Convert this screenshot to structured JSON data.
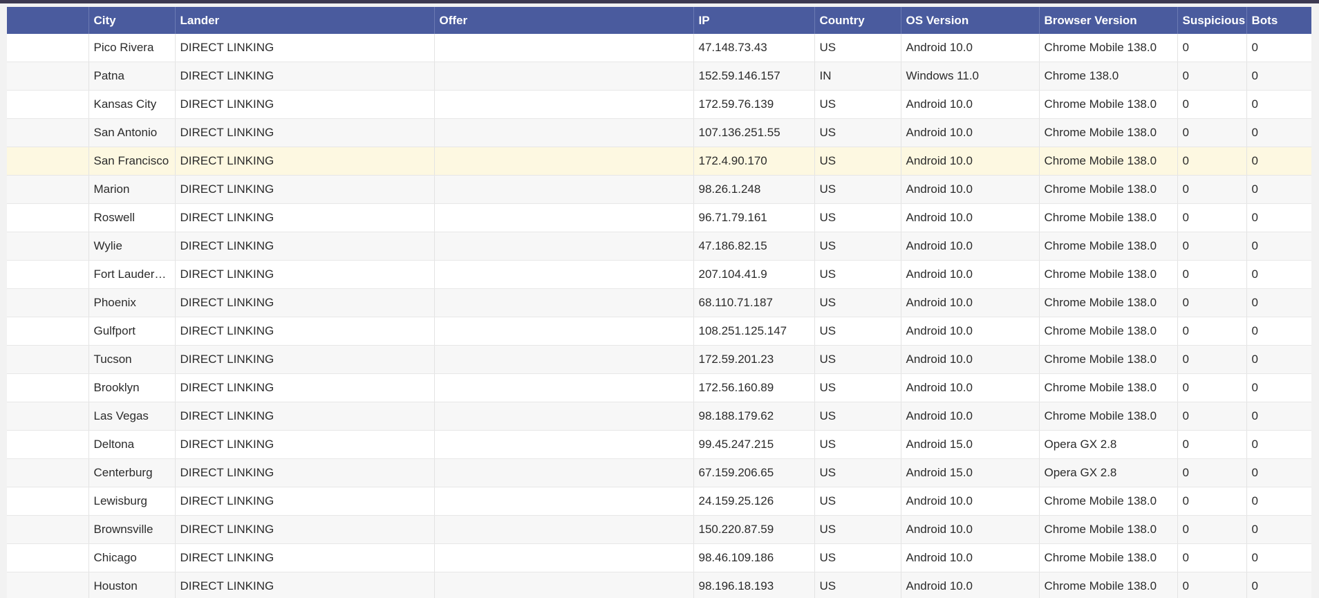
{
  "columns": [
    "",
    "City",
    "Lander",
    "Offer",
    "IP",
    "Country",
    "OS Version",
    "Browser Version",
    "Suspicious",
    "Bots"
  ],
  "rows": [
    {
      "city": "Pico Rivera",
      "lander": "DIRECT LINKING",
      "offer": "",
      "ip": "47.148.73.43",
      "country": "US",
      "os": "Android 10.0",
      "browser": "Chrome Mobile 138.0",
      "suspicious": "0",
      "bots": "0"
    },
    {
      "city": "Patna",
      "lander": "DIRECT LINKING",
      "offer": "",
      "ip": "152.59.146.157",
      "country": "IN",
      "os": "Windows 11.0",
      "browser": "Chrome 138.0",
      "suspicious": "0",
      "bots": "0"
    },
    {
      "city": "Kansas City",
      "lander": "DIRECT LINKING",
      "offer": "",
      "ip": "172.59.76.139",
      "country": "US",
      "os": "Android 10.0",
      "browser": "Chrome Mobile 138.0",
      "suspicious": "0",
      "bots": "0"
    },
    {
      "city": "San Antonio",
      "lander": "DIRECT LINKING",
      "offer": "",
      "ip": "107.136.251.55",
      "country": "US",
      "os": "Android 10.0",
      "browser": "Chrome Mobile 138.0",
      "suspicious": "0",
      "bots": "0"
    },
    {
      "city": "San Francisco",
      "lander": "DIRECT LINKING",
      "offer": "",
      "ip": "172.4.90.170",
      "country": "US",
      "os": "Android 10.0",
      "browser": "Chrome Mobile 138.0",
      "suspicious": "0",
      "bots": "0",
      "highlighted": true
    },
    {
      "city": "Marion",
      "lander": "DIRECT LINKING",
      "offer": "",
      "ip": "98.26.1.248",
      "country": "US",
      "os": "Android 10.0",
      "browser": "Chrome Mobile 138.0",
      "suspicious": "0",
      "bots": "0"
    },
    {
      "city": "Roswell",
      "lander": "DIRECT LINKING",
      "offer": "",
      "ip": "96.71.79.161",
      "country": "US",
      "os": "Android 10.0",
      "browser": "Chrome Mobile 138.0",
      "suspicious": "0",
      "bots": "0"
    },
    {
      "city": "Wylie",
      "lander": "DIRECT LINKING",
      "offer": "",
      "ip": "47.186.82.15",
      "country": "US",
      "os": "Android 10.0",
      "browser": "Chrome Mobile 138.0",
      "suspicious": "0",
      "bots": "0"
    },
    {
      "city": "Fort Lauderd...",
      "lander": "DIRECT LINKING",
      "offer": "",
      "ip": "207.104.41.9",
      "country": "US",
      "os": "Android 10.0",
      "browser": "Chrome Mobile 138.0",
      "suspicious": "0",
      "bots": "0"
    },
    {
      "city": "Phoenix",
      "lander": "DIRECT LINKING",
      "offer": "",
      "ip": "68.110.71.187",
      "country": "US",
      "os": "Android 10.0",
      "browser": "Chrome Mobile 138.0",
      "suspicious": "0",
      "bots": "0"
    },
    {
      "city": "Gulfport",
      "lander": "DIRECT LINKING",
      "offer": "",
      "ip": "108.251.125.147",
      "country": "US",
      "os": "Android 10.0",
      "browser": "Chrome Mobile 138.0",
      "suspicious": "0",
      "bots": "0"
    },
    {
      "city": "Tucson",
      "lander": "DIRECT LINKING",
      "offer": "",
      "ip": "172.59.201.23",
      "country": "US",
      "os": "Android 10.0",
      "browser": "Chrome Mobile 138.0",
      "suspicious": "0",
      "bots": "0"
    },
    {
      "city": "Brooklyn",
      "lander": "DIRECT LINKING",
      "offer": "",
      "ip": "172.56.160.89",
      "country": "US",
      "os": "Android 10.0",
      "browser": "Chrome Mobile 138.0",
      "suspicious": "0",
      "bots": "0"
    },
    {
      "city": "Las Vegas",
      "lander": "DIRECT LINKING",
      "offer": "",
      "ip": "98.188.179.62",
      "country": "US",
      "os": "Android 10.0",
      "browser": "Chrome Mobile 138.0",
      "suspicious": "0",
      "bots": "0"
    },
    {
      "city": "Deltona",
      "lander": "DIRECT LINKING",
      "offer": "",
      "ip": "99.45.247.215",
      "country": "US",
      "os": "Android 15.0",
      "browser": "Opera GX 2.8",
      "suspicious": "0",
      "bots": "0"
    },
    {
      "city": "Centerburg",
      "lander": "DIRECT LINKING",
      "offer": "",
      "ip": "67.159.206.65",
      "country": "US",
      "os": "Android 15.0",
      "browser": "Opera GX 2.8",
      "suspicious": "0",
      "bots": "0"
    },
    {
      "city": "Lewisburg",
      "lander": "DIRECT LINKING",
      "offer": "",
      "ip": "24.159.25.126",
      "country": "US",
      "os": "Android 10.0",
      "browser": "Chrome Mobile 138.0",
      "suspicious": "0",
      "bots": "0"
    },
    {
      "city": "Brownsville",
      "lander": "DIRECT LINKING",
      "offer": "",
      "ip": "150.220.87.59",
      "country": "US",
      "os": "Android 10.0",
      "browser": "Chrome Mobile 138.0",
      "suspicious": "0",
      "bots": "0"
    },
    {
      "city": "Chicago",
      "lander": "DIRECT LINKING",
      "offer": "",
      "ip": "98.46.109.186",
      "country": "US",
      "os": "Android 10.0",
      "browser": "Chrome Mobile 138.0",
      "suspicious": "0",
      "bots": "0"
    },
    {
      "city": "Houston",
      "lander": "DIRECT LINKING",
      "offer": "",
      "ip": "98.196.18.193",
      "country": "US",
      "os": "Android 10.0",
      "browser": "Chrome Mobile 138.0",
      "suspicious": "0",
      "bots": "0"
    }
  ],
  "colors": {
    "header_bg": "#4a5b9e",
    "highlight_row": "#fdf8e1",
    "top_bar": "#3d3a52"
  }
}
